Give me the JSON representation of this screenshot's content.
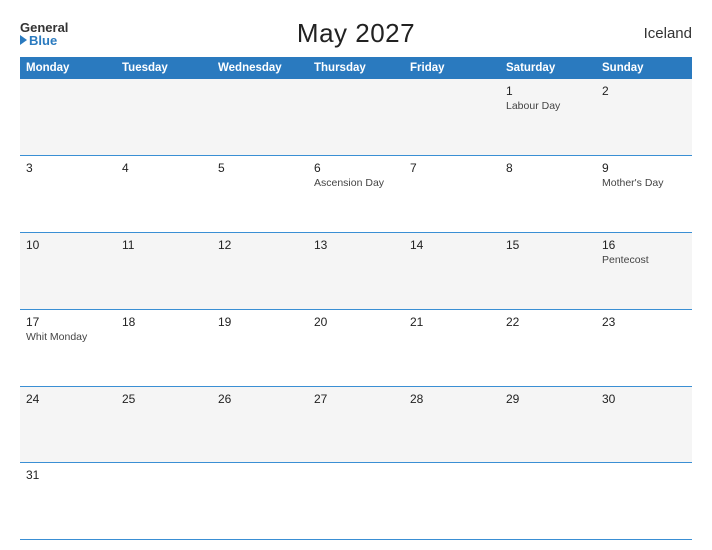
{
  "header": {
    "logo_general": "General",
    "logo_blue": "Blue",
    "title": "May 2027",
    "country": "Iceland"
  },
  "days_of_week": [
    "Monday",
    "Tuesday",
    "Wednesday",
    "Thursday",
    "Friday",
    "Saturday",
    "Sunday"
  ],
  "weeks": [
    [
      {
        "num": "",
        "holiday": ""
      },
      {
        "num": "",
        "holiday": ""
      },
      {
        "num": "",
        "holiday": ""
      },
      {
        "num": "",
        "holiday": ""
      },
      {
        "num": "",
        "holiday": ""
      },
      {
        "num": "1",
        "holiday": "Labour Day"
      },
      {
        "num": "2",
        "holiday": ""
      }
    ],
    [
      {
        "num": "3",
        "holiday": ""
      },
      {
        "num": "4",
        "holiday": ""
      },
      {
        "num": "5",
        "holiday": ""
      },
      {
        "num": "6",
        "holiday": "Ascension Day"
      },
      {
        "num": "7",
        "holiday": ""
      },
      {
        "num": "8",
        "holiday": ""
      },
      {
        "num": "9",
        "holiday": "Mother's Day"
      }
    ],
    [
      {
        "num": "10",
        "holiday": ""
      },
      {
        "num": "11",
        "holiday": ""
      },
      {
        "num": "12",
        "holiday": ""
      },
      {
        "num": "13",
        "holiday": ""
      },
      {
        "num": "14",
        "holiday": ""
      },
      {
        "num": "15",
        "holiday": ""
      },
      {
        "num": "16",
        "holiday": "Pentecost"
      }
    ],
    [
      {
        "num": "17",
        "holiday": "Whit Monday"
      },
      {
        "num": "18",
        "holiday": ""
      },
      {
        "num": "19",
        "holiday": ""
      },
      {
        "num": "20",
        "holiday": ""
      },
      {
        "num": "21",
        "holiday": ""
      },
      {
        "num": "22",
        "holiday": ""
      },
      {
        "num": "23",
        "holiday": ""
      }
    ],
    [
      {
        "num": "24",
        "holiday": ""
      },
      {
        "num": "25",
        "holiday": ""
      },
      {
        "num": "26",
        "holiday": ""
      },
      {
        "num": "27",
        "holiday": ""
      },
      {
        "num": "28",
        "holiday": ""
      },
      {
        "num": "29",
        "holiday": ""
      },
      {
        "num": "30",
        "holiday": ""
      }
    ],
    [
      {
        "num": "31",
        "holiday": ""
      },
      {
        "num": "",
        "holiday": ""
      },
      {
        "num": "",
        "holiday": ""
      },
      {
        "num": "",
        "holiday": ""
      },
      {
        "num": "",
        "holiday": ""
      },
      {
        "num": "",
        "holiday": ""
      },
      {
        "num": "",
        "holiday": ""
      }
    ]
  ]
}
